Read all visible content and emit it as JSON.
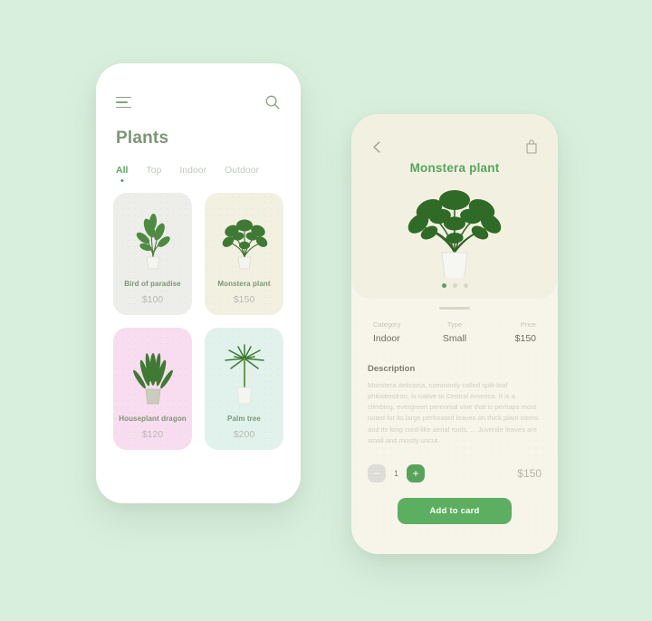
{
  "theme": {
    "page_bg": "#d9efdd",
    "accent_green": "#5caf60",
    "sage": "#7d9674",
    "cream": "#f2f0e1",
    "sheet": "#f7f5ea"
  },
  "list_screen": {
    "menu_icon": "hamburger-icon",
    "search_icon": "search-icon",
    "title": "Plants",
    "tabs": [
      {
        "label": "All",
        "active": true
      },
      {
        "label": "Top",
        "active": false
      },
      {
        "label": "Indoor",
        "active": false
      },
      {
        "label": "Outdoor",
        "active": false
      }
    ],
    "products": [
      {
        "name": "Bird of paradise",
        "price": "$100",
        "bg": "#ededea",
        "art": "bird"
      },
      {
        "name": "Monstera plant",
        "price": "$150",
        "bg": "#f2f0e1",
        "art": "monstera"
      },
      {
        "name": "Houseplant dragon",
        "price": "$120",
        "bg": "#f8dcef",
        "art": "snake"
      },
      {
        "name": "Palm tree",
        "price": "$200",
        "bg": "#e1f2ec",
        "art": "palm"
      }
    ]
  },
  "detail_screen": {
    "back_icon": "chevron-left-icon",
    "bag_icon": "shopping-bag-icon",
    "title": "Monstera plant",
    "carousel": {
      "total": 3,
      "active_index": 0
    },
    "specs": [
      {
        "label": "Category",
        "value": "Indoor"
      },
      {
        "label": "Type",
        "value": "Small"
      },
      {
        "label": "Price",
        "value": "$150"
      }
    ],
    "description_heading": "Description",
    "description_body": "Monstera deliciosa, commonly called split-leaf philodendron, is native to Central America. It is a climbing, evergreen perennial vine that is perhaps most noted for its large perforated leaves on thick plant stems and its long cord-like aerial roots. ... Juvenile leaves are small and mostly uncut.",
    "quantity": {
      "decrement_label": "−",
      "value": "1",
      "increment_label": "+"
    },
    "total_price": "$150",
    "add_button_label": "Add to card"
  }
}
